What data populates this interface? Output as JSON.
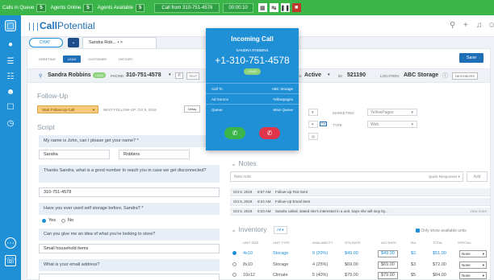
{
  "topbar": {
    "calls_label": "Calls in Queue",
    "calls_count": "5",
    "online_label": "Agents Online",
    "online_count": "5",
    "available_label": "Agents Available",
    "available_count": "5",
    "call_from": "Call from 310-751-4578",
    "timer": "00:00:10"
  },
  "header": {
    "logo_bold": "Call",
    "logo_rest": "Potential"
  },
  "tabs": {
    "chat": "CHAT",
    "record": "Sandra Rob... • ×"
  },
  "subtabs": [
    "GREETING",
    "LEAD",
    "CUSTOMER",
    "HISTORY"
  ],
  "save_label": "Save",
  "contact": {
    "name": "Sandra Robbins",
    "badge": "LEAD",
    "phone_label": "PHONE:",
    "phone": "310-751-4578",
    "text_btn": "TEXT",
    "status_label": "STATUS:",
    "status": "Active",
    "id_label": "ID:",
    "id": "521190",
    "location_label": "LOCATION:",
    "location": "ABC Storage",
    "neighbors": "NEIGHBORS"
  },
  "followup": {
    "title": "Follow-Up",
    "button": "Start Follow-Up Call",
    "next_label": "NEXT FOLLOW-UP: Oct 9, 2019",
    "delay": "Delay"
  },
  "script": {
    "title": "Script",
    "q1": "My name is John, can I please get your name? *",
    "first": "Sandra",
    "last": "Robbins",
    "q2": "Thanks Sandra, what is a good number to reach you in case we get disconnected?",
    "phone": "310-751-4578",
    "q3": "Have you ever used self storage before, Sandra? *",
    "yes": "Yes",
    "no": "No",
    "q4": "Can you give me an idea of what you're looking to store?",
    "store": "Small household items",
    "q5": "What is your email address?"
  },
  "marketing": {
    "label": "MARKETING",
    "value": "YellowPages",
    "type_label": "TYPE",
    "type_value": "Web",
    "pm": "PM"
  },
  "notes": {
    "title": "Notes",
    "placeholder": "New note",
    "quick": "Quick Responses ▾",
    "add": "Add",
    "rows": [
      {
        "date": "Oct 6, 2019",
        "time": "8:57 AM",
        "text": "Follow-Up Text Sent",
        "extra": ""
      },
      {
        "date": "Oct 5, 2019",
        "time": "9:24 AM",
        "text": "Follow-Up Email Sent",
        "extra": ""
      },
      {
        "date": "Oct 5, 2019",
        "time": "9:23 AM",
        "text": "Sandra called, stated she's interested in a unit. Says she will stop by...",
        "extra": "view more"
      }
    ]
  },
  "inventory": {
    "title": "Inventory",
    "filter": "All ▾",
    "only_available": "Only show available units",
    "headers": [
      "UNIT SIZE",
      "UNIT TYPE",
      "AVAILABILITY",
      "STD RATE",
      "ADJ RATE",
      "TAX",
      "TOTAL",
      "SPECIAL"
    ],
    "rows": [
      {
        "size": "4x10",
        "type": "Storage",
        "avail": "9 (20%)",
        "std": "$49.00",
        "adj": "$49.00",
        "tax": "$2.",
        "total": "$51.00",
        "special": "None"
      },
      {
        "size": "8x10",
        "type": "Storage",
        "avail": "4 (25%)",
        "std": "$69.00",
        "adj": "$69.00",
        "tax": "$3",
        "total": "$72.00",
        "special": "None"
      },
      {
        "size": "10x12",
        "type": "Climate",
        "avail": "5 (40%)",
        "std": "$79.00",
        "adj": "$79.00",
        "tax": "$5",
        "total": "$84.00",
        "special": "None"
      }
    ]
  },
  "popup": {
    "title": "Incoming Call",
    "name": "SANDRA ROBBINS",
    "number": "+1-310-751-4578",
    "badge": "LEAD",
    "call_to_label": "Call To",
    "call_to": "ABC Storage",
    "source_label": "Ad Source",
    "source": "Yellowpages",
    "queue_label": "Queue",
    "queue": "Main Queue"
  },
  "colors": {
    "green": "#3bb54a",
    "blue": "#1f8fd6",
    "navy": "#1e6fb8",
    "red": "#e0344a"
  }
}
